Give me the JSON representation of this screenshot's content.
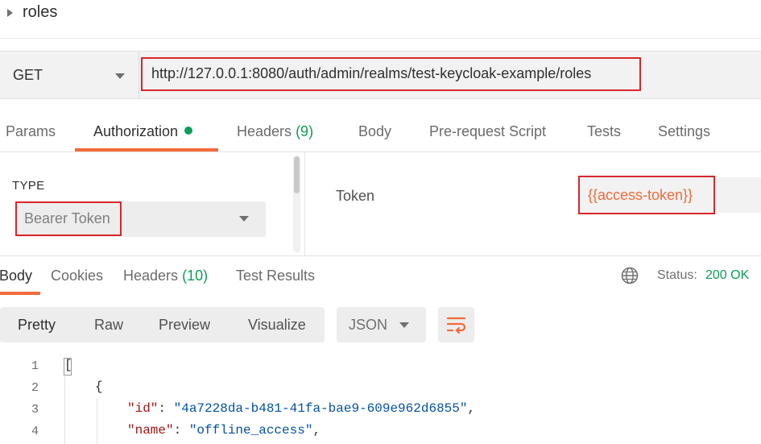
{
  "request": {
    "name": "roles",
    "method": "GET",
    "url": "http://127.0.0.1:8080/auth/admin/realms/test-keycloak-example/roles"
  },
  "tabs": {
    "params": "Params",
    "authorization": "Authorization",
    "headers": "Headers",
    "headers_count": "(9)",
    "body": "Body",
    "prerequest": "Pre-request Script",
    "tests": "Tests",
    "settings": "Settings",
    "active": "Authorization"
  },
  "auth": {
    "type_label": "TYPE",
    "type_value": "Bearer Token",
    "token_label": "Token",
    "token_value": "{{access-token}}"
  },
  "response": {
    "tabs": {
      "body": "Body",
      "cookies": "Cookies",
      "headers": "Headers",
      "headers_count": "(10)",
      "test_results": "Test Results"
    },
    "status_label": "Status:",
    "status_value": "200 OK",
    "view_modes": [
      "Pretty",
      "Raw",
      "Preview",
      "Visualize"
    ],
    "active_view": "Pretty",
    "format": "JSON",
    "lines": [
      {
        "num": "1",
        "text": "["
      },
      {
        "num": "2",
        "text": "{"
      },
      {
        "num": "3",
        "key": "\"id\"",
        "sep": ": ",
        "value": "\"4a7228da-b481-41fa-bae9-609e962d6855\"",
        "end": ","
      },
      {
        "num": "4",
        "key": "\"name\"",
        "sep": ": ",
        "value": "\"offline_access\"",
        "end": ","
      }
    ]
  },
  "icons": {
    "expand": "caret-right-icon",
    "globe": "globe-icon",
    "wrap": "wrap-lines-icon"
  },
  "colors": {
    "accent": "#f26b3a",
    "success": "#0d9d58",
    "highlight_box": "#d9262c"
  }
}
